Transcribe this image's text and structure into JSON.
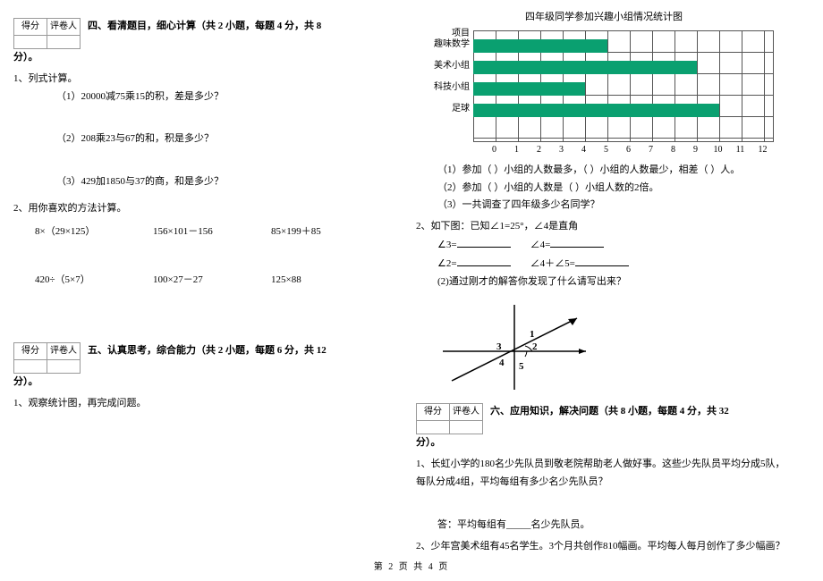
{
  "score_table": {
    "h1": "得分",
    "h2": "评卷人"
  },
  "sec4": {
    "title": "四、看清题目，细心计算（共 2 小题，每题 4 分，共 8",
    "title_cont": "分）。",
    "q1": {
      "label": "1、列式计算。",
      "a": "（1）20000减75乘15的积，差是多少？",
      "b": "（2）208乘23与67的和，积是多少？",
      "c": "（3）429加1850与37的商，和是多少？"
    },
    "q2": {
      "label": "2、用你喜欢的方法计算。",
      "row1": [
        "8×（29×125）",
        "156×101－156",
        "85×199＋85"
      ],
      "row2": [
        "420÷（5×7）",
        "100×27－27",
        "125×88"
      ]
    }
  },
  "sec5": {
    "title": "五、认真思考，综合能力（共 2 小题，每题 6 分，共 12",
    "title_cont": "分）。",
    "q1": "1、观察统计图，再完成问题。"
  },
  "chart_data": {
    "type": "bar",
    "orientation": "horizontal",
    "title": "四年级同学参加兴趣小组情况统计图",
    "ylabel": "项目",
    "categories": [
      "趣味数学",
      "美术小组",
      "科技小组",
      "足球"
    ],
    "values": [
      6,
      10,
      5,
      11
    ],
    "xlim": [
      0,
      12
    ],
    "xticks": [
      0,
      1,
      2,
      3,
      4,
      5,
      6,
      7,
      8,
      9,
      10,
      11,
      12
    ]
  },
  "chart_q": {
    "a": "（1）参加（          ）小组的人数最多，（          ）小组的人数最少，相差（      ）人。",
    "b": "（2）参加（          ）小组的人数是（                  ）小组人数的2倍。",
    "c": "（3）一共调查了四年级多少名同学？"
  },
  "q_angle": {
    "intro": "2、如下图：已知∠1=25°，∠4是直角",
    "l1a": "∠3=",
    "l1b": "∠4=",
    "l2a": "∠2=",
    "l2b": "∠4＋∠5=",
    "l3": "(2)通过刚才的解答你发现了什么请写出来？"
  },
  "sec6": {
    "title": "六、应用知识，解决问题（共 8 小题，每题 4 分，共 32",
    "title_cont": "分）。",
    "q1": "1、长虹小学的180名少先队员到敬老院帮助老人做好事。这些少先队员平均分成5队，每队分成4组，平均每组有多少名少先队员？",
    "ans1": "答：平均每组有_____名少先队员。",
    "q2": "2、少年宫美术组有45名学生。3个月共创作810幅画。平均每人每月创作了多少幅画？"
  },
  "footer": "第 2 页 共 4 页"
}
